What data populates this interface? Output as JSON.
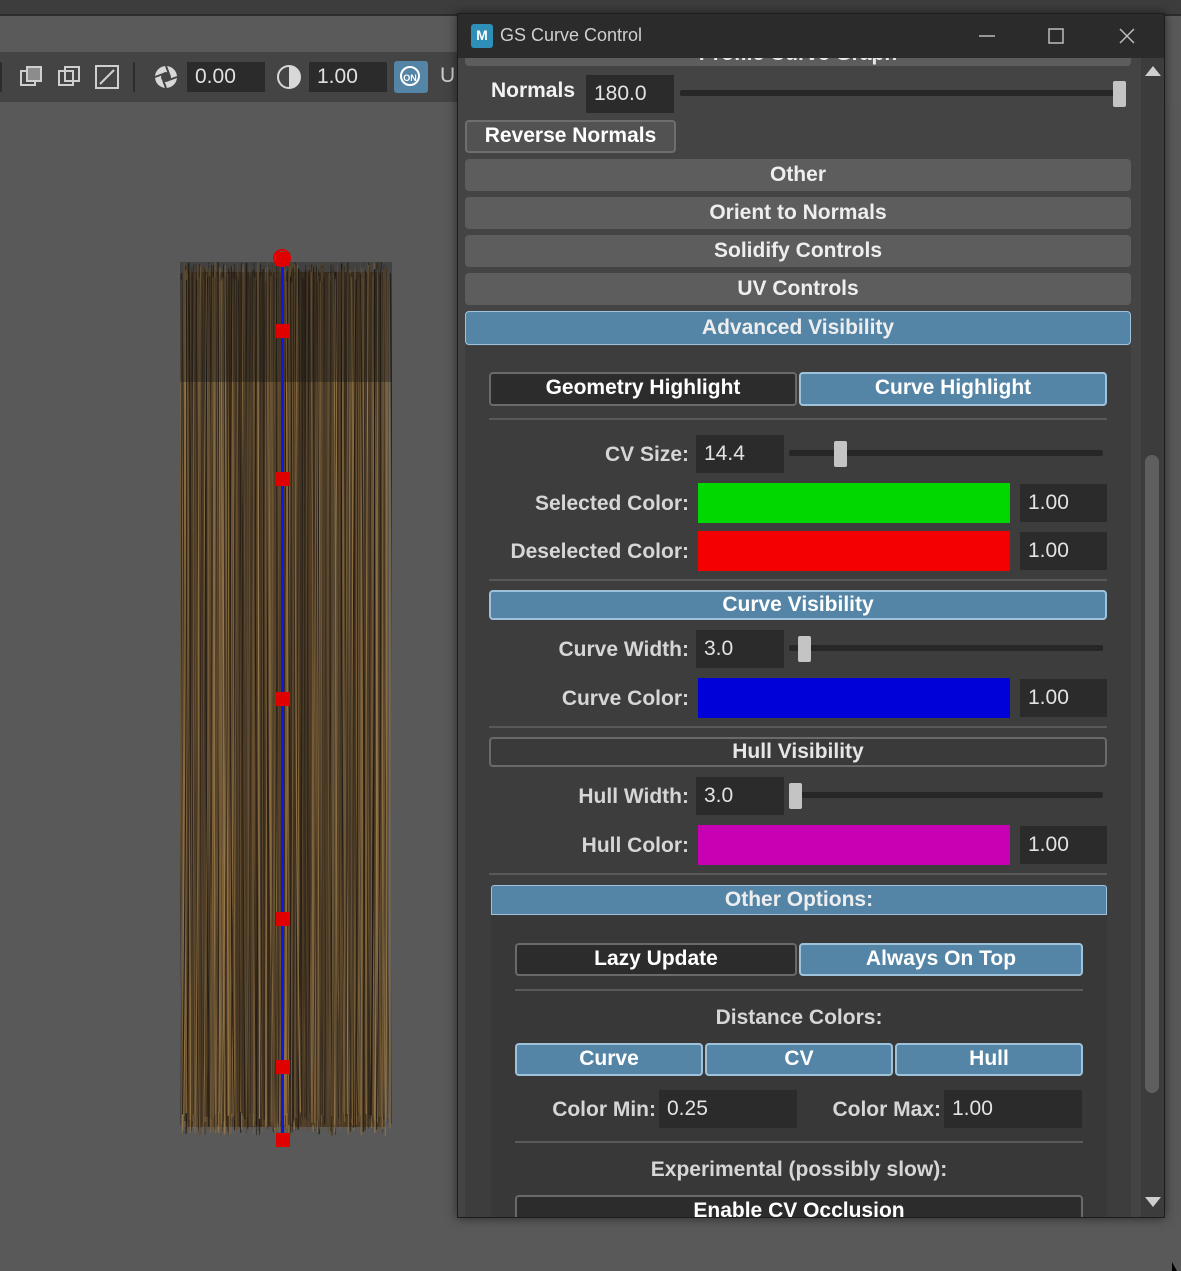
{
  "viewport_toolbar": {
    "field1": "0.00",
    "field2": "1.00",
    "on_badge": "ON",
    "trailing_text": "U"
  },
  "window": {
    "app_icon": "M",
    "title": "GS Curve Control",
    "minimize_icon": "minimize-icon",
    "maximize_icon": "maximize-icon",
    "close_icon": "close-icon"
  },
  "top_partial_header": "Profile Curve Graph",
  "normals": {
    "label": "Normals",
    "value": "180.0",
    "slider_fraction": 1.0
  },
  "reverse_normals_label": "Reverse Normals",
  "collapsed_sections": [
    "Other",
    "Orient to Normals",
    "Solidify Controls",
    "UV Controls"
  ],
  "advanced_visibility": {
    "header": "Advanced Visibility",
    "geometry_highlight": "Geometry Highlight",
    "curve_highlight": "Curve Highlight",
    "cv_size": {
      "label": "CV Size:",
      "value": "14.4",
      "slider_fraction": 0.15
    },
    "selected_color": {
      "label": "Selected Color:",
      "color": "#00d800",
      "alpha": "1.00"
    },
    "deselected_color": {
      "label": "Deselected Color:",
      "color": "#f40000",
      "alpha": "1.00"
    },
    "curve_visibility": {
      "label": "Curve Visibility",
      "width": {
        "label": "Curve Width:",
        "value": "3.0",
        "slider_fraction": 0.03
      },
      "color": {
        "label": "Curve Color:",
        "color": "#0000d8",
        "alpha": "1.00"
      }
    },
    "hull_visibility": {
      "label": "Hull Visibility",
      "width": {
        "label": "Hull Width:",
        "value": "3.0",
        "slider_fraction": 0.0
      },
      "color": {
        "label": "Hull Color:",
        "color": "#c800b4",
        "alpha": "1.00"
      }
    },
    "other_options": {
      "header": "Other Options:",
      "lazy_update": "Lazy Update",
      "always_on_top": "Always On Top",
      "distance_colors_label": "Distance Colors:",
      "distance_buttons": [
        "Curve",
        "CV",
        "Hull"
      ],
      "color_min": {
        "label": "Color Min:",
        "value": "0.25"
      },
      "color_max": {
        "label": "Color Max:",
        "value": "1.00"
      },
      "experimental_label": "Experimental (possibly slow):",
      "enable_cv_occlusion": "Enable CV Occlusion"
    }
  },
  "colors": {
    "accent": "#5585a6",
    "panel": "#444444",
    "curve": "#1515e0",
    "cv_point": "#e00000"
  }
}
